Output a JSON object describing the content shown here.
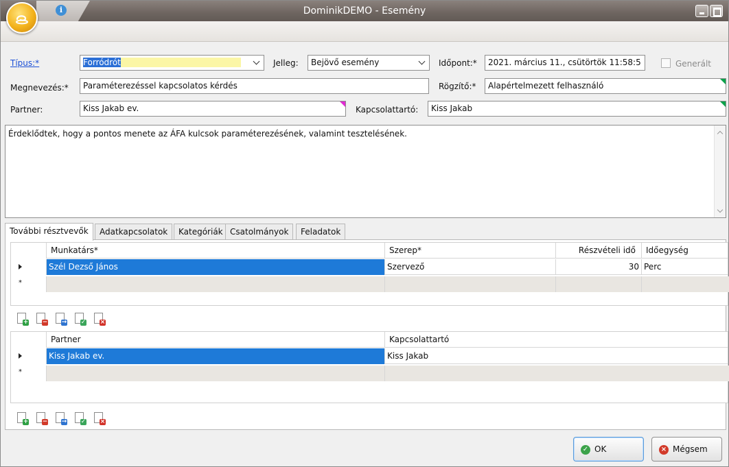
{
  "window": {
    "title": "DominikDEMO - Esemény"
  },
  "form": {
    "tipus": {
      "label": "Típus:*",
      "value": "Forródrót"
    },
    "jelleg": {
      "label": "Jelleg:",
      "value": "Bejövő esemény"
    },
    "idopont": {
      "label": "Időpont:*",
      "value": "2021. március 11., csütörtök 11:58:5"
    },
    "generalt": {
      "label": "Generált",
      "checked": false
    },
    "megnevezes": {
      "label": "Megnevezés:*",
      "value": "Paraméterezéssel kapcsolatos kérdés"
    },
    "rogzito": {
      "label": "Rögzítő:*",
      "value": "Alapértelmezett felhasználó"
    },
    "partner": {
      "label": "Partner:",
      "value": "Kiss Jakab ev."
    },
    "kapcsolattarto": {
      "label": "Kapcsolattartó:",
      "value": "Kiss Jakab"
    },
    "memo": "Érdeklődtek, hogy a pontos menete az ÁFA kulcsok paraméterezésének, valamint tesztelésének."
  },
  "tabs": [
    {
      "label": "További résztvevők",
      "active": true
    },
    {
      "label": "Adatkapcsolatok"
    },
    {
      "label": "Kategóriák"
    },
    {
      "label": "Csatolmányok"
    },
    {
      "label": "Feladatok"
    }
  ],
  "grid1": {
    "columns": [
      "Munkatárs*",
      "Szerep*",
      "Részvételi idő",
      "Időegység"
    ],
    "rows": [
      {
        "munkatars": "Szél Dezső János",
        "szerep": "Szervező",
        "ido": "30",
        "egyseg": "Perc"
      }
    ]
  },
  "grid2": {
    "columns": [
      "Partner",
      "Kapcsolattartó"
    ],
    "rows": [
      {
        "partner": "Kiss Jakab ev.",
        "kapcsolattarto": "Kiss Jakab"
      }
    ]
  },
  "toolbar_icons": [
    "add-icon",
    "remove-icon",
    "forward-icon",
    "edit-icon",
    "delete-icon"
  ],
  "buttons": {
    "ok": "OK",
    "cancel": "Mégsem"
  },
  "colors": {
    "selection": "#1e7ad8",
    "ok_icon": "#3ca34a",
    "cancel_icon": "#d23a2a"
  }
}
